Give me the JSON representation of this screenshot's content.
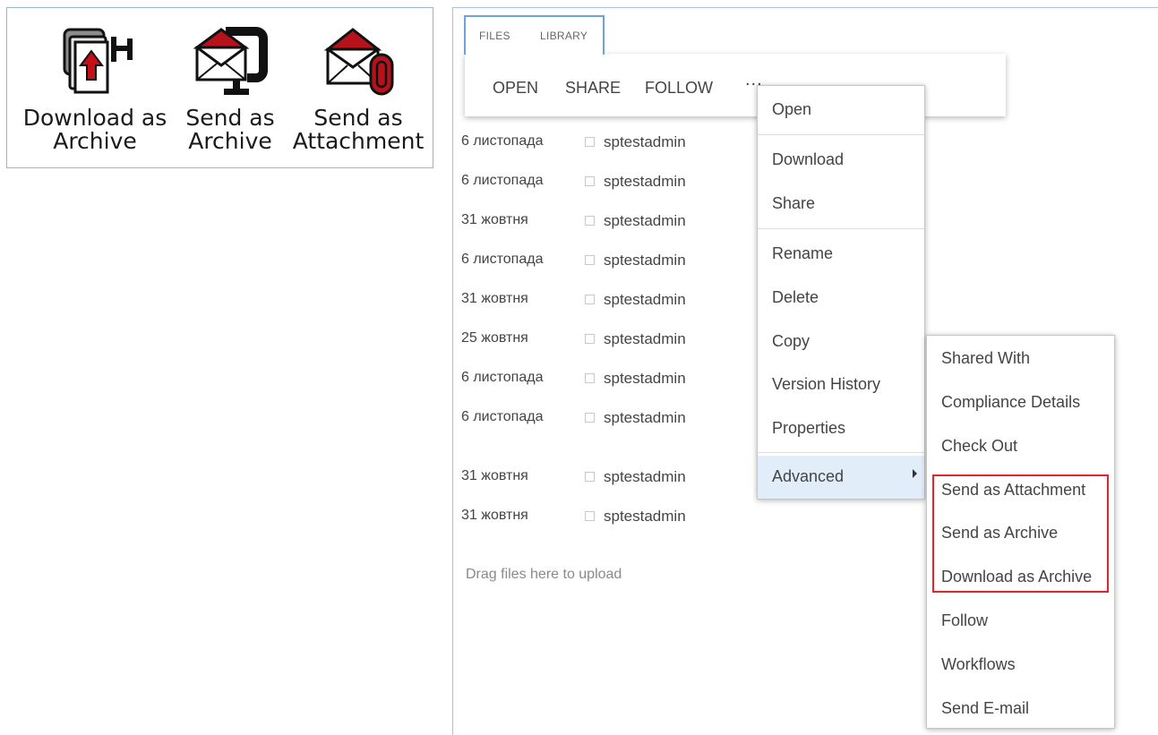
{
  "ribbon": {
    "buttons": [
      {
        "label": "Download as Archive",
        "icon": "download-archive-icon"
      },
      {
        "label": "Send as Archive",
        "icon": "send-archive-icon"
      },
      {
        "label": "Send as Attachment",
        "icon": "send-attachment-icon"
      }
    ],
    "colors": {
      "border": "#9bb4d6",
      "icon_red": "#b5121b"
    }
  },
  "tabs": [
    "FILES",
    "LIBRARY"
  ],
  "commands": {
    "open": "OPEN",
    "share": "SHARE",
    "follow": "FOLLOW",
    "more": "..."
  },
  "rows": [
    {
      "date": "6 листопада",
      "user": "sptestadmin"
    },
    {
      "date": "6 листопада",
      "user": "sptestadmin"
    },
    {
      "date": "31 жовтня",
      "user": "sptestadmin"
    },
    {
      "date": "6 листопада",
      "user": "sptestadmin"
    },
    {
      "date": "31 жовтня",
      "user": "sptestadmin"
    },
    {
      "date": "25 жовтня",
      "user": "sptestadmin"
    },
    {
      "date": "6 листопада",
      "user": "sptestadmin"
    },
    {
      "date": "6 листопада",
      "user": "sptestadmin"
    },
    {
      "date": "31 жовтня",
      "user": "sptestadmin"
    },
    {
      "date": "31 жовтня",
      "user": "sptestadmin"
    }
  ],
  "drop_hint": "Drag files here to upload",
  "context_menu": {
    "items": [
      "Open",
      "Download",
      "Share",
      "Rename",
      "Delete",
      "Copy",
      "Version History",
      "Properties",
      "Advanced"
    ],
    "highlight_color": "#e1edf9"
  },
  "advanced_menu": {
    "items": [
      "Shared With",
      "Compliance Details",
      "Check Out",
      "Send as Attachment",
      "Send as Archive",
      "Download as Archive",
      "Follow",
      "Workflows",
      "Send E-mail"
    ],
    "highlight_border": "#e2242c"
  }
}
